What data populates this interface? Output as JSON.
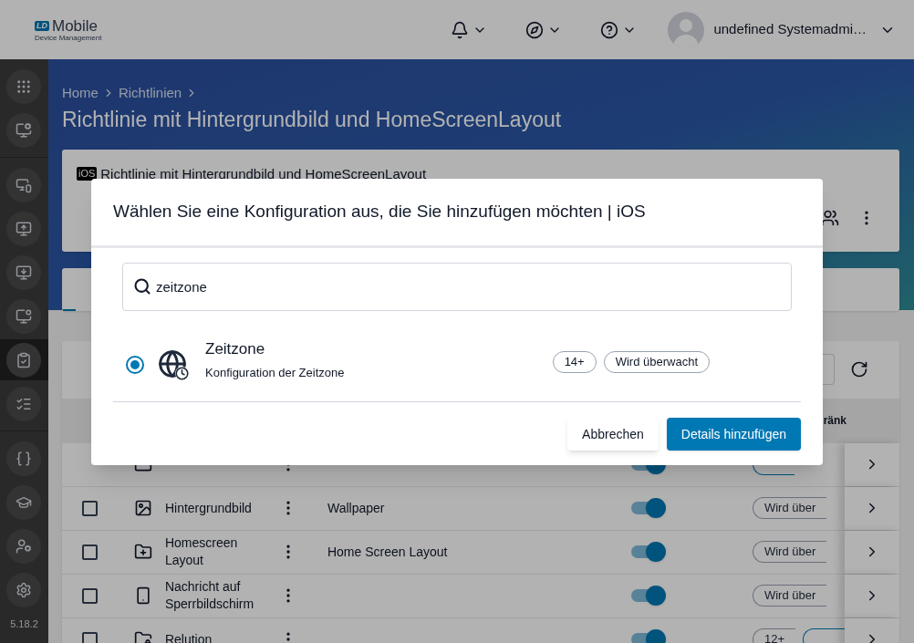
{
  "logo": {
    "badge": "LD",
    "name": "Mobile",
    "subtitle": "Device Management"
  },
  "topbar": {
    "user_name": "undefined Systemadmi…"
  },
  "sidebar": {
    "groups": [
      [
        {
          "kind": "grid",
          "selected": false
        },
        {
          "kind": "monitor-star",
          "selected": false
        }
      ],
      [
        {
          "kind": "devices",
          "selected": false
        },
        {
          "kind": "monitor-plus-arrow",
          "selected": false
        },
        {
          "kind": "monitor-download",
          "selected": false
        },
        {
          "kind": "monitor-plus",
          "selected": false
        },
        {
          "kind": "phone-check",
          "selected": true
        },
        {
          "kind": "list-check",
          "selected": false
        }
      ],
      [
        {
          "kind": "braces",
          "selected": false
        },
        {
          "kind": "graduation",
          "selected": false
        },
        {
          "kind": "user-gear",
          "selected": false
        },
        {
          "kind": "gear",
          "selected": false
        }
      ]
    ],
    "version": "5.18.2"
  },
  "breadcrumb": [
    "Home",
    "Richtlinien"
  ],
  "page_title": "Richtlinie mit Hintergrundbild und HomeScreenLayout",
  "policy_card": {
    "platform": "iOS",
    "title": "Richtlinie mit Hintergrundbild und HomeScreenLayout"
  },
  "table": {
    "header_visible": "ränk",
    "rows": [
      {
        "kind": "app-check",
        "on": true,
        "badges": [
          {
            "kind": "blue"
          }
        ]
      },
      {
        "kind": "image",
        "name": "Hintergrundbild",
        "value": "Wallpaper",
        "checked": false,
        "on": true,
        "badges": [
          {
            "text": "Wird über",
            "kind": "plain"
          }
        ]
      },
      {
        "kind": "folder-plus",
        "name": "Homescreen Layout",
        "value": "Home Screen Layout",
        "checked": false,
        "on": true,
        "badges": [
          {
            "text": "Wird über",
            "kind": "plain"
          }
        ]
      },
      {
        "kind": "phone-lock",
        "name": "Nachricht auf Sperrbildschirm",
        "value": "",
        "checked": false,
        "on": true,
        "badges": [
          {
            "text": "Wird über",
            "kind": "plain"
          }
        ]
      },
      {
        "kind": "folder-user",
        "name": "Relution",
        "value": "",
        "checked": false,
        "on": true,
        "badges": [
          {
            "text": "12+",
            "kind": "plain"
          },
          {
            "kind": "blue"
          }
        ]
      }
    ]
  },
  "dialog": {
    "title": "Wählen Sie eine Konfiguration aus, die Sie hinzufügen möchten | iOS",
    "search": {
      "value": "zeitzone"
    },
    "results": [
      {
        "name": "Zeitzone",
        "description": "Konfiguration der Zeitzone",
        "selected": true,
        "badges": [
          "14+",
          "Wird überwacht"
        ]
      }
    ],
    "buttons": [
      {
        "label": "Abbrechen",
        "kind": "secondary"
      },
      {
        "label": "Details hinzufügen",
        "kind": "primary"
      }
    ]
  }
}
